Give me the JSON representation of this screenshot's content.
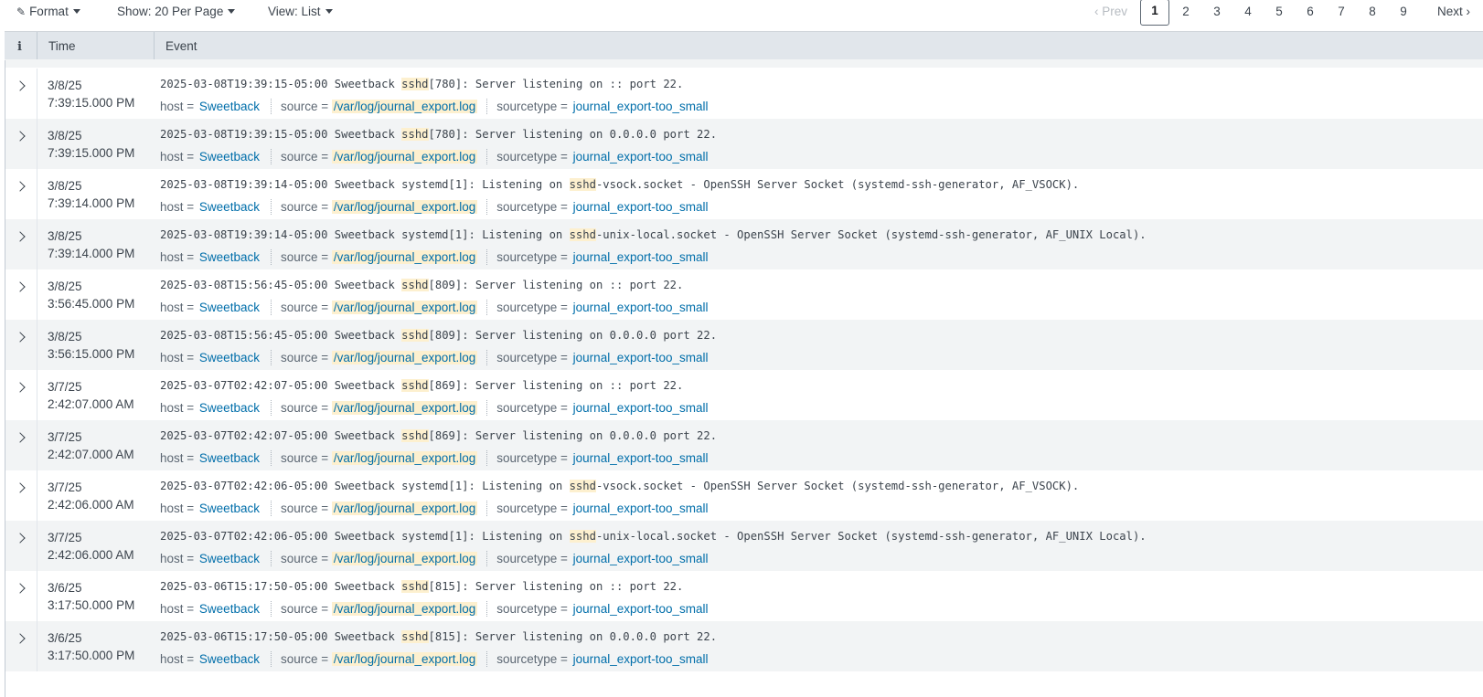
{
  "toolbar": {
    "format_label": "Format",
    "show_label": "Show: 20 Per Page",
    "view_label": "View: List"
  },
  "pager": {
    "prev": "Prev",
    "next": "Next",
    "pages": [
      "1",
      "2",
      "3",
      "4",
      "5",
      "6",
      "7",
      "8",
      "9"
    ],
    "current": "1"
  },
  "columns": {
    "info": "i",
    "time": "Time",
    "event": "Event"
  },
  "field_keys": {
    "host": "host =",
    "source": "source =",
    "sourcetype": "sourcetype ="
  },
  "events": [
    {
      "date": "3/8/25",
      "time": "7:39:15.000 PM",
      "pre": "2025-03-08T19:39:15-05:00 Sweetback ",
      "hl": "sshd",
      "post": "[780]: Server listening on :: port 22.",
      "host": "Sweetback",
      "source": "/var/log/journal_export.log",
      "sourcetype": "journal_export-too_small"
    },
    {
      "date": "3/8/25",
      "time": "7:39:15.000 PM",
      "pre": "2025-03-08T19:39:15-05:00 Sweetback ",
      "hl": "sshd",
      "post": "[780]: Server listening on 0.0.0.0 port 22.",
      "host": "Sweetback",
      "source": "/var/log/journal_export.log",
      "sourcetype": "journal_export-too_small"
    },
    {
      "date": "3/8/25",
      "time": "7:39:14.000 PM",
      "pre": "2025-03-08T19:39:14-05:00 Sweetback systemd[1]: Listening on ",
      "hl": "sshd",
      "post": "-vsock.socket - OpenSSH Server Socket (systemd-ssh-generator, AF_VSOCK).",
      "host": "Sweetback",
      "source": "/var/log/journal_export.log",
      "sourcetype": "journal_export-too_small"
    },
    {
      "date": "3/8/25",
      "time": "7:39:14.000 PM",
      "pre": "2025-03-08T19:39:14-05:00 Sweetback systemd[1]: Listening on ",
      "hl": "sshd",
      "post": "-unix-local.socket - OpenSSH Server Socket (systemd-ssh-generator, AF_UNIX Local).",
      "host": "Sweetback",
      "source": "/var/log/journal_export.log",
      "sourcetype": "journal_export-too_small"
    },
    {
      "date": "3/8/25",
      "time": "3:56:45.000 PM",
      "pre": "2025-03-08T15:56:45-05:00 Sweetback ",
      "hl": "sshd",
      "post": "[809]: Server listening on :: port 22.",
      "host": "Sweetback",
      "source": "/var/log/journal_export.log",
      "sourcetype": "journal_export-too_small"
    },
    {
      "date": "3/8/25",
      "time": "3:56:15.000 PM",
      "pre": "2025-03-08T15:56:45-05:00 Sweetback ",
      "hl": "sshd",
      "post": "[809]: Server listening on 0.0.0.0 port 22.",
      "host": "Sweetback",
      "source": "/var/log/journal_export.log",
      "sourcetype": "journal_export-too_small"
    },
    {
      "date": "3/7/25",
      "time": "2:42:07.000 AM",
      "pre": "2025-03-07T02:42:07-05:00 Sweetback ",
      "hl": "sshd",
      "post": "[869]: Server listening on :: port 22.",
      "host": "Sweetback",
      "source": "/var/log/journal_export.log",
      "sourcetype": "journal_export-too_small"
    },
    {
      "date": "3/7/25",
      "time": "2:42:07.000 AM",
      "pre": "2025-03-07T02:42:07-05:00 Sweetback ",
      "hl": "sshd",
      "post": "[869]: Server listening on 0.0.0.0 port 22.",
      "host": "Sweetback",
      "source": "/var/log/journal_export.log",
      "sourcetype": "journal_export-too_small"
    },
    {
      "date": "3/7/25",
      "time": "2:42:06.000 AM",
      "pre": "2025-03-07T02:42:06-05:00 Sweetback systemd[1]: Listening on ",
      "hl": "sshd",
      "post": "-vsock.socket - OpenSSH Server Socket (systemd-ssh-generator, AF_VSOCK).",
      "host": "Sweetback",
      "source": "/var/log/journal_export.log",
      "sourcetype": "journal_export-too_small"
    },
    {
      "date": "3/7/25",
      "time": "2:42:06.000 AM",
      "pre": "2025-03-07T02:42:06-05:00 Sweetback systemd[1]: Listening on ",
      "hl": "sshd",
      "post": "-unix-local.socket - OpenSSH Server Socket (systemd-ssh-generator, AF_UNIX Local).",
      "host": "Sweetback",
      "source": "/var/log/journal_export.log",
      "sourcetype": "journal_export-too_small"
    },
    {
      "date": "3/6/25",
      "time": "3:17:50.000 PM",
      "pre": "2025-03-06T15:17:50-05:00 Sweetback ",
      "hl": "sshd",
      "post": "[815]: Server listening on :: port 22.",
      "host": "Sweetback",
      "source": "/var/log/journal_export.log",
      "sourcetype": "journal_export-too_small"
    },
    {
      "date": "3/6/25",
      "time": "3:17:50.000 PM",
      "pre": "2025-03-06T15:17:50-05:00 Sweetback ",
      "hl": "sshd",
      "post": "[815]: Server listening on 0.0.0.0 port 22.",
      "host": "Sweetback",
      "source": "/var/log/journal_export.log",
      "sourcetype": "journal_export-too_small"
    }
  ]
}
